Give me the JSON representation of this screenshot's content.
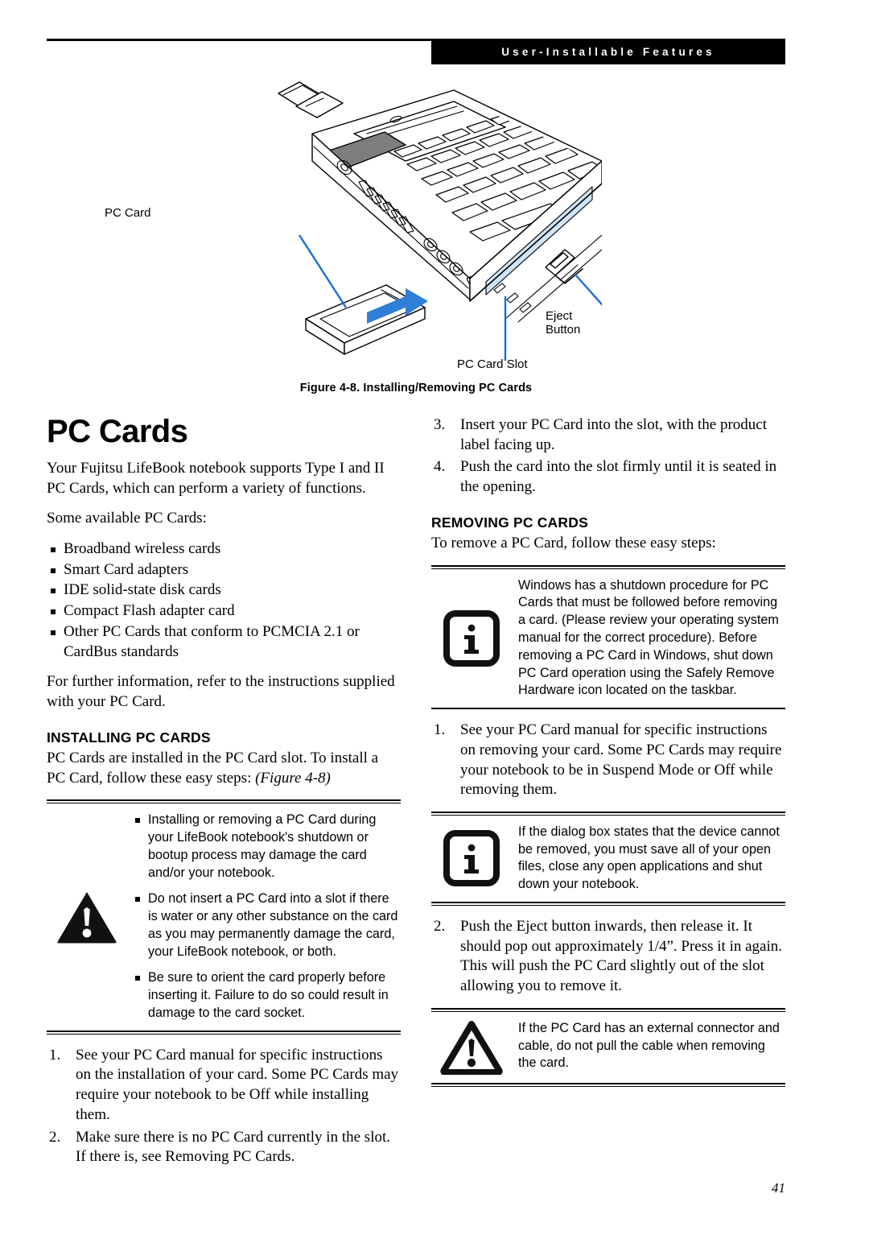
{
  "header": {
    "running_head": "User-Installable Features"
  },
  "figure": {
    "labels": {
      "pc_card": "PC Card",
      "eject_button": "Eject Button",
      "pc_card_slot": "PC Card Slot"
    },
    "caption": "Figure 4-8.  Installing/Removing PC Cards",
    "accent_color": "#1a6fd4"
  },
  "left_column": {
    "title": "PC Cards",
    "intro": "Your Fujitsu LifeBook notebook supports Type I and II PC Cards, which can perform a variety of functions.",
    "available_lead": "Some available PC Cards:",
    "available_list": [
      "Broadband wireless cards",
      "Smart Card adapters",
      "IDE solid-state disk cards",
      "Compact Flash adapter card",
      "Other PC Cards that conform to PCMCIA 2.1 or CardBus standards"
    ],
    "further_info": "For further information, refer to the instructions supplied with your PC Card.",
    "installing_heading": "INSTALLING PC CARDS",
    "installing_intro_plain": "PC Cards are installed in the PC Card slot. To install a PC Card, follow these easy steps: ",
    "installing_intro_italic": "(Figure 4-8)",
    "warning_callout": {
      "icon": "warning-triangle-filled-icon",
      "items": [
        "Installing or removing a PC Card during your LifeBook notebook's shutdown or bootup process may damage the card and/or your notebook.",
        "Do not insert a PC Card into a slot if there is water or any other substance on the card as you may permanently damage the card, your LifeBook notebook, or both.",
        "Be sure to orient the card properly before inserting it. Failure to do so could result in damage to the card socket."
      ]
    },
    "install_steps": [
      {
        "num": "1.",
        "text": "See your PC Card manual for specific instructions on the installation of your card. Some PC Cards may require your notebook to be Off while installing them."
      },
      {
        "num": "2.",
        "text": "Make sure there is no PC Card currently in the slot. If there is, see Removing PC Cards."
      }
    ]
  },
  "right_column": {
    "install_steps_cont": [
      {
        "num": "3.",
        "text": "Insert your PC Card into the slot, with the product label facing up."
      },
      {
        "num": "4.",
        "text": "Push the card into the slot firmly until it is seated in the opening."
      }
    ],
    "removing_heading": "REMOVING PC CARDS",
    "removing_intro": "To remove a PC Card, follow these easy steps:",
    "info_callout_1": {
      "icon": "info-i-icon",
      "text": "Windows has a shutdown procedure for PC Cards that must be followed before removing a card. (Please review your operating system manual for the correct procedure). Before removing a PC Card in Windows, shut down PC Card operation using the Safely Remove Hardware icon located on the taskbar."
    },
    "remove_step_1": {
      "num": "1.",
      "text": "See your PC Card manual for specific instructions on removing your card. Some PC Cards may require your notebook to be in Suspend Mode or Off while removing them."
    },
    "info_callout_2": {
      "icon": "info-i-icon",
      "text": "If the dialog box states that the device cannot be removed, you must save all of your open files, close any open applications and shut down your notebook."
    },
    "remove_step_2": {
      "num": "2.",
      "text": "Push the Eject button inwards, then release it. It should pop out approximately 1/4”. Press it in again. This will push the PC Card slightly out of the slot allowing you to remove it."
    },
    "warning_callout_2": {
      "icon": "warning-triangle-outline-icon",
      "text": "If the PC Card has an external connector and cable, do not pull the cable when removing the card."
    }
  },
  "footer": {
    "page_number": "41"
  }
}
